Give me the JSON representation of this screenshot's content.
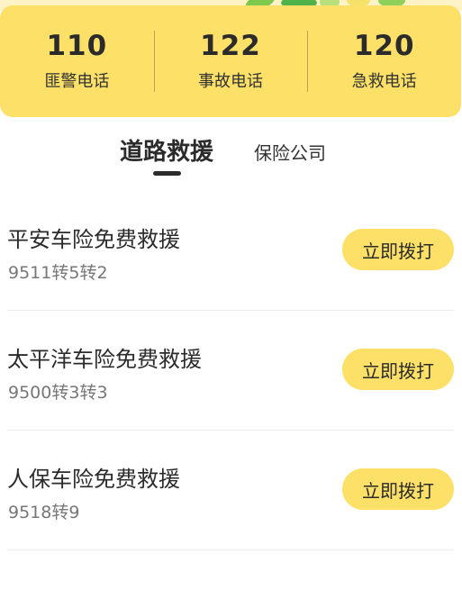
{
  "hotlines": [
    {
      "number": "110",
      "label": "匪警电话"
    },
    {
      "number": "122",
      "label": "事故电话"
    },
    {
      "number": "120",
      "label": "急救电话"
    }
  ],
  "tabs": {
    "road_rescue": "道路救援",
    "insurance": "保险公司",
    "active": "road_rescue"
  },
  "rescue_list": [
    {
      "title": "平安车险免费救援",
      "phone": "9511转5转2",
      "button": "立即拨打"
    },
    {
      "title": "太平洋车险免费救援",
      "phone": "9500转3转3",
      "button": "立即拨打"
    },
    {
      "title": "人保车险免费救援",
      "phone": "9518转9",
      "button": "立即拨打"
    }
  ],
  "colors": {
    "accent_yellow": "#fde067",
    "text_dark": "#2b2b2b",
    "text_muted": "#777777"
  }
}
